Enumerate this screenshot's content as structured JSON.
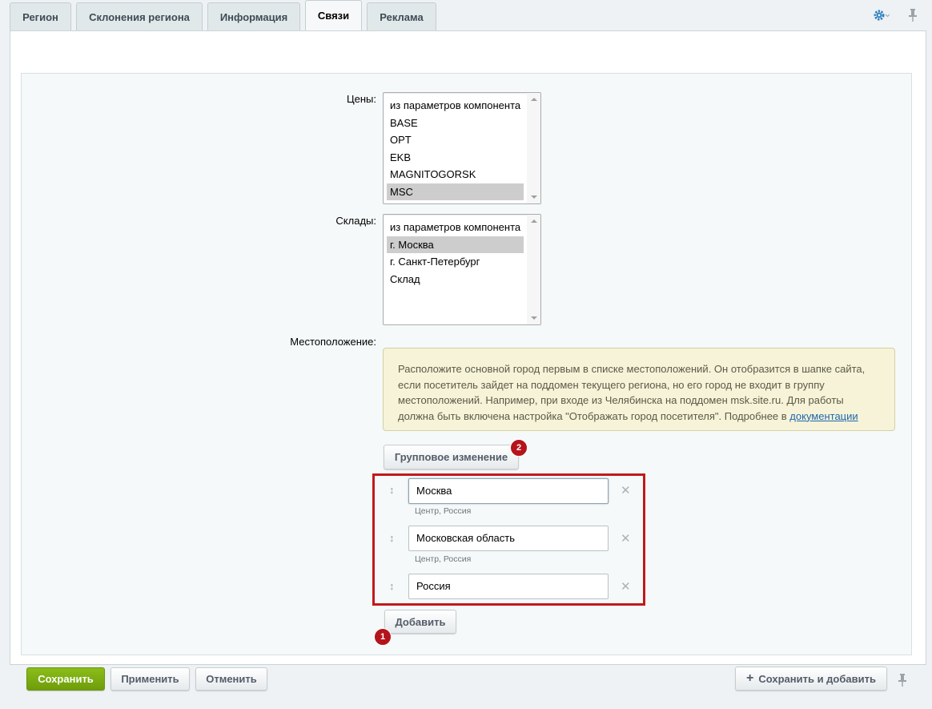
{
  "tabs": [
    {
      "label": "Регион"
    },
    {
      "label": "Склонения региона"
    },
    {
      "label": "Информация"
    },
    {
      "label": "Связи",
      "active": true
    },
    {
      "label": "Реклама"
    }
  ],
  "header_icons": {
    "settings": "gear-icon",
    "pin": "pin-icon",
    "accent": "#2d7fbd"
  },
  "prices": {
    "label": "Цены:",
    "options": [
      "из параметров компонента",
      "BASE",
      "OPT",
      "EKB",
      "MAGNITOGORSK",
      "MSC"
    ],
    "selected": "MSC"
  },
  "stores": {
    "label": "Склады:",
    "options": [
      "из параметров компонента",
      "г. Москва",
      "г. Санкт-Петербург",
      "Склад"
    ],
    "selected": "г. Москва"
  },
  "location": {
    "label": "Местоположение:",
    "note_text": "Расположите основной город первым в списке местоположений. Он отобразится в шапке сайта, если посетитель зайдет на поддомен текущего региона, но его город не входит в группу местоположений. Например, при входе из Челябинска на поддомен msk.site.ru. Для работы должна быть включена настройка \"Отображать город посетителя\". Подробнее в ",
    "note_link": "документации",
    "group_change_label": "Групповое изменение",
    "items": [
      {
        "value": "Москва",
        "sub": "Центр, Россия"
      },
      {
        "value": "Московская область",
        "sub": "Центр, Россия"
      },
      {
        "value": "Россия",
        "sub": ""
      }
    ],
    "add_label": "Добавить",
    "badge_1": "1",
    "badge_2": "2"
  },
  "footer": {
    "save": "Сохранить",
    "apply": "Применить",
    "cancel": "Отменить",
    "save_add": "Сохранить и добавить"
  },
  "colors": {
    "save_green": "#7aab12",
    "highlight_red": "#c11a1c",
    "badge_red": "#b5141c",
    "note_bg": "#f6f3d8"
  }
}
